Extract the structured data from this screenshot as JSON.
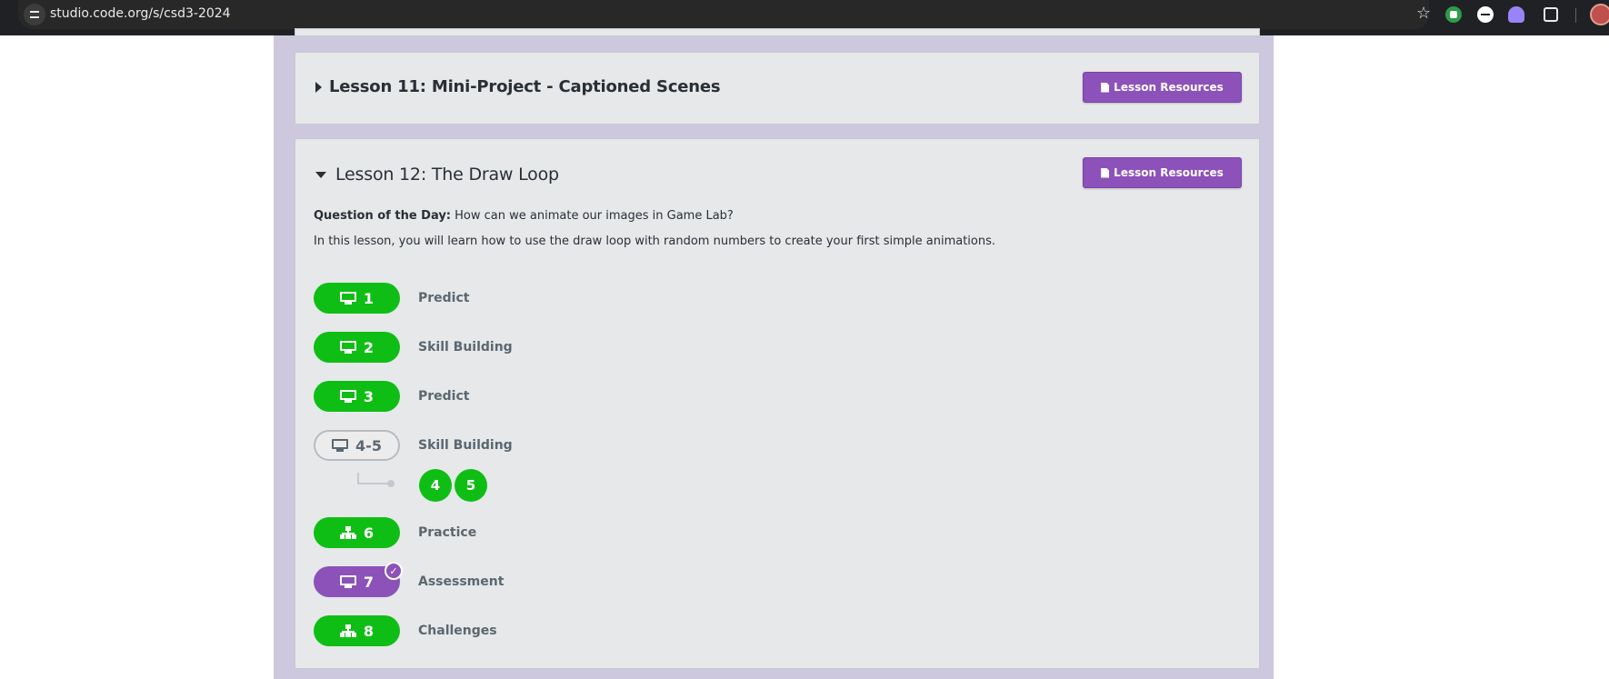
{
  "browser": {
    "url": "studio.code.org/s/csd3-2024"
  },
  "lessons": [
    {
      "title": "Lesson 11: Mini-Project - Captioned Scenes",
      "resources_label": "Lesson Resources",
      "expanded": false
    },
    {
      "title": "Lesson 12: The Draw Loop",
      "resources_label": "Lesson Resources",
      "expanded": true,
      "question_label": "Question of the Day:",
      "question_text": "How can we animate our images in Game Lab?",
      "description": "In this lesson, you will learn how to use the draw loop with random numbers to create your first simple animations.",
      "levels": [
        {
          "number": "1",
          "label": "Predict",
          "icon": "monitor-icon",
          "status": "completed"
        },
        {
          "number": "2",
          "label": "Skill Building",
          "icon": "monitor-icon",
          "status": "completed"
        },
        {
          "number": "3",
          "label": "Predict",
          "icon": "monitor-icon",
          "status": "completed"
        },
        {
          "number": "4-5",
          "label": "Skill Building",
          "icon": "monitor-icon",
          "status": "not-started",
          "sublevels": [
            "4",
            "5"
          ]
        },
        {
          "number": "6",
          "label": "Practice",
          "icon": "tree-icon",
          "status": "completed"
        },
        {
          "number": "7",
          "label": "Assessment",
          "icon": "monitor-icon",
          "status": "submitted"
        },
        {
          "number": "8",
          "label": "Challenges",
          "icon": "tree-icon",
          "status": "completed"
        }
      ]
    }
  ],
  "colors": {
    "completed": "#0fbe14",
    "assessment": "#8c52ba",
    "resources_button": "#8c52ba",
    "page_background": "#cdc8dd",
    "card_background": "#e6e8ea"
  }
}
